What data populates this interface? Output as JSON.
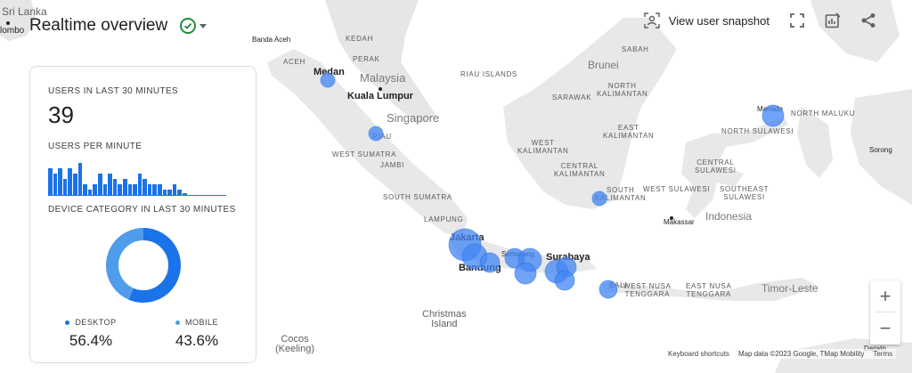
{
  "header": {
    "title": "Realtime overview"
  },
  "toolbar": {
    "snapshot_label": "View user snapshot"
  },
  "card": {
    "users_30_caption": "USERS IN LAST 30 MINUTES",
    "users_30_value": "39",
    "users_per_minute_caption": "USERS PER MINUTE",
    "users_per_minute": [
      5,
      4,
      5,
      3,
      5,
      4,
      6,
      2,
      1,
      2,
      4,
      2,
      4,
      3,
      2,
      3,
      2,
      2,
      4,
      3,
      2,
      2,
      2,
      1,
      1,
      2,
      1,
      0.3
    ],
    "device_caption": "DEVICE CATEGORY IN LAST 30 MINUTES",
    "devices": [
      {
        "name": "DESKTOP",
        "pct": "56.4%",
        "value": 56.4,
        "color": "#1a73e8"
      },
      {
        "name": "MOBILE",
        "pct": "43.6%",
        "value": 43.6,
        "color": "#4e9ceb"
      }
    ]
  },
  "map": {
    "labels": {
      "sri_lanka": "Sri Lanka",
      "colombo": "lombo",
      "banda_aceh": "Banda Aceh",
      "kedah": "KEDAH",
      "aceh": "ACEH",
      "perak": "PERAK",
      "malaysia": "Malaysia",
      "medan": "Medan",
      "kuala_lumpur": "Kuala Lumpur",
      "riau_islands": "RIAU ISLANDS",
      "singapore": "Singapore",
      "riau": "RIAU",
      "west_sumatra": "WEST SUMATRA",
      "jambi": "JAMBI",
      "south_sumatra": "SOUTH SUMATRA",
      "lampung": "LAMPUNG",
      "jakarta": "Jakarta",
      "semarang": "Semarang",
      "bandung": "Bandung",
      "surabaya": "Surabaya",
      "bali": "BALI",
      "west_nusa_tenggara": "WEST NUSA\nTENGGARA",
      "east_nusa_tenggara": "EAST NUSA\nTENGGARA",
      "timor_leste": "Timor-Leste",
      "christmas_island": "Christmas\nIsland",
      "cocos": "Cocos\n(Keeling)",
      "sabah": "SABAH",
      "brunei": "Brunei",
      "sarawak": "SARAWAK",
      "north_kalimantan": "NORTH\nKALIMANTAN",
      "east_kalimantan": "EAST\nKALIMANTAN",
      "west_kalimantan": "WEST\nKALIMANTAN",
      "central_kalimantan": "CENTRAL\nKALIMANTAN",
      "south_kalimantan": "SOUTH\nKALIMANTAN",
      "manado": "Manado",
      "north_maluku": "NORTH MALUKU",
      "north_sulawesi": "NORTH SULAWESI",
      "central_sulawesi": "CENTRAL\nSULAWESI",
      "west_sulawesi": "WEST SULAWESI",
      "southeast_sulawesi": "SOUTHEAST\nSULAWESI",
      "makassar": "Makassar",
      "indonesia": "Indonesia",
      "sorong": "Sorong",
      "darwin": "Darwin"
    }
  },
  "zoom": {
    "in": "+",
    "out": "−"
  },
  "footer": {
    "shortcuts": "Keyboard shortcuts",
    "map_data": "Map data ©2023 Google, TMap Mobility",
    "terms": "Terms"
  },
  "colors": {
    "accent": "#1a73e8",
    "bubble": "#4285f4",
    "land": "#e8e8e8",
    "status": "#1e8e3e"
  }
}
